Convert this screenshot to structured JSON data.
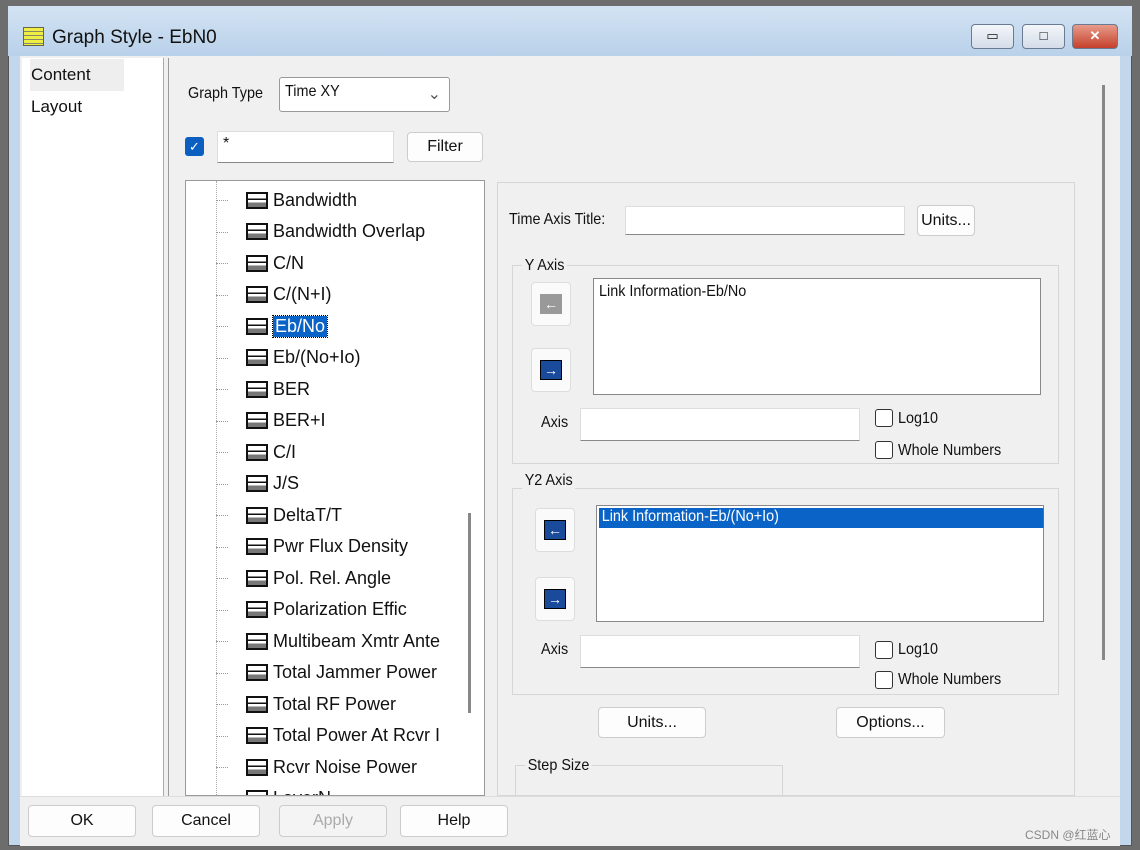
{
  "window": {
    "title": "Graph Style - EbN0",
    "minimize": "▭",
    "maximize": "□",
    "close": "✕"
  },
  "nav": {
    "items": [
      {
        "label": "Content",
        "selected": true
      },
      {
        "label": "Layout"
      }
    ]
  },
  "content": {
    "graph_type_label": "Graph Type",
    "graph_type_value": "Time XY",
    "filter_checked": true,
    "filter_value": "*",
    "filter_button": "Filter",
    "tree_items": [
      "Bandwidth",
      "Bandwidth Overlap",
      "C/N",
      "C/(N+I)",
      "Eb/No",
      "Eb/(No+Io)",
      "BER",
      "BER+I",
      "C/I",
      "J/S",
      "DeltaT/T",
      "Pwr Flux Density",
      "Pol. Rel. Angle",
      "Polarization Effic",
      "Multibeam Xmtr Ante",
      "Total Jammer Power",
      "Total RF Power",
      "Total Power At Rcvr I",
      "Rcvr Noise Power",
      "LayerN"
    ],
    "tree_selected": "Eb/No",
    "time_axis_title_label": "Time Axis Title:",
    "time_axis_title_value": "",
    "units_button": "Units...",
    "y_axis": {
      "label": "Y Axis",
      "items": [
        "Link Information-Eb/No"
      ],
      "axis_label": "Axis",
      "axis_value": "",
      "log10": "Log10",
      "whole_numbers": "Whole Numbers"
    },
    "y2_axis": {
      "label": "Y2 Axis",
      "items": [
        "Link Information-Eb/(No+Io)"
      ],
      "axis_label": "Axis",
      "axis_value": "",
      "log10": "Log10",
      "whole_numbers": "Whole Numbers"
    },
    "units_button2": "Units...",
    "options_button": "Options...",
    "step_size_label": "Step Size"
  },
  "footer": {
    "ok": "OK",
    "cancel": "Cancel",
    "apply": "Apply",
    "help": "Help"
  },
  "watermark": "CSDN @红蓝心"
}
